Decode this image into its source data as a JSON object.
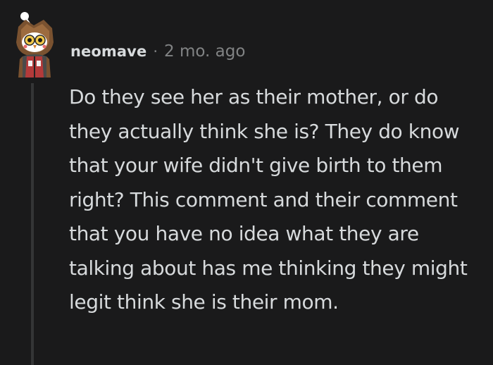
{
  "comment": {
    "avatar_icon": "snoo-owl-avatar-icon",
    "username": "neomave",
    "separator": "·",
    "timestamp": "2 mo. ago",
    "body": "Do they see her as their mother, or do they actually think she is? They do know that your wife didn't give birth to them right? This comment and their comment that you have no idea what they are talking about has me thinking they might legit think she is their mom."
  },
  "colors": {
    "background": "#1a1a1b",
    "text": "#d7dadc",
    "muted": "#818384",
    "thread_line": "#343536"
  }
}
